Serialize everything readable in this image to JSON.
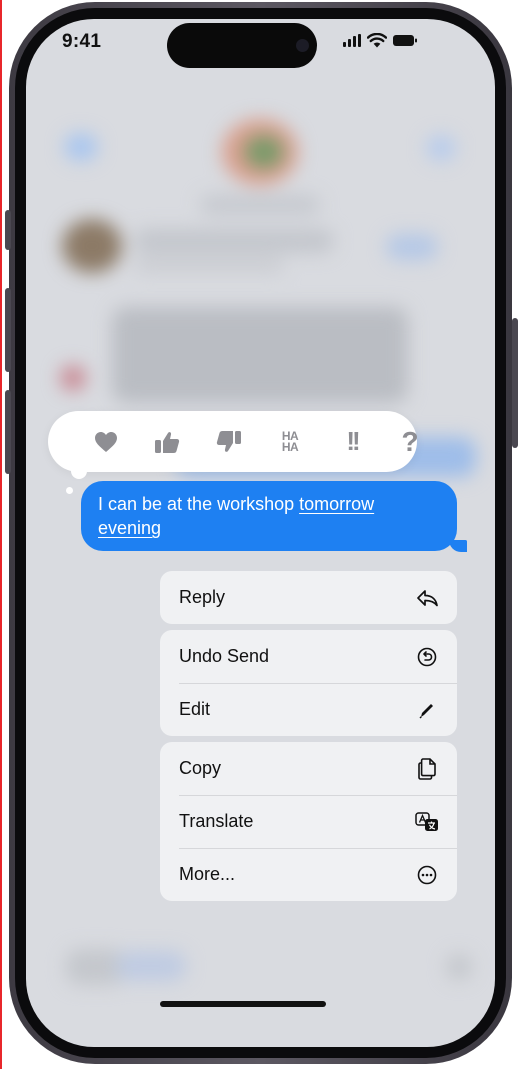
{
  "status_bar": {
    "time": "9:41"
  },
  "tapback": {
    "items": [
      {
        "icon": "heart-icon"
      },
      {
        "icon": "thumbs-up-icon"
      },
      {
        "icon": "thumbs-down-icon"
      },
      {
        "icon": "haha-icon",
        "label_top": "HA",
        "label_bottom": "HA"
      },
      {
        "icon": "exclamation-icon",
        "label": "!!"
      },
      {
        "icon": "question-icon",
        "label": "?"
      }
    ]
  },
  "message": {
    "text_plain": "I can be at the workshop ",
    "text_link_1": "tomorrow",
    "text_link_2": "evening",
    "bubble_color": "#1e80f2"
  },
  "menu": {
    "groups": [
      {
        "items": [
          {
            "label": "Reply",
            "icon": "reply-icon"
          }
        ]
      },
      {
        "items": [
          {
            "label": "Undo Send",
            "icon": "undo-send-icon"
          },
          {
            "label": "Edit",
            "icon": "pencil-icon"
          }
        ]
      },
      {
        "items": [
          {
            "label": "Copy",
            "icon": "copy-icon"
          },
          {
            "label": "Translate",
            "icon": "translate-icon"
          },
          {
            "label": "More...",
            "icon": "more-icon"
          }
        ]
      }
    ]
  }
}
